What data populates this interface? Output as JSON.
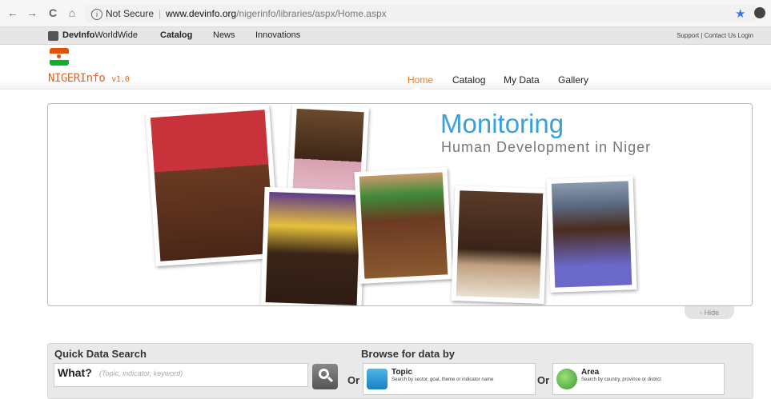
{
  "browser": {
    "back": "←",
    "forward": "→",
    "reload": "C",
    "home": "⌂",
    "security_label": "Not Secure",
    "url_domain": "www.devinfo.org",
    "url_path": "/nigerinfo/libraries/aspx/Home.aspx",
    "star": "★"
  },
  "topbar": {
    "brand_bold": "DevInfo",
    "brand_rest": "WorldWide",
    "items": [
      "Catalog",
      "News",
      "Innovations"
    ],
    "support": "Support | Contact Us Login"
  },
  "header": {
    "title": "NIGERInfo",
    "version": "v1.0",
    "nav": [
      "Home",
      "Catalog",
      "My Data",
      "Gallery"
    ],
    "active": "Home",
    "flag_colors": [
      "#e05206",
      "#ffffff",
      "#0db02b"
    ]
  },
  "banner": {
    "title": "Monitoring",
    "subtitle": "Human Development in Niger",
    "hide_label": "Hide"
  },
  "search": {
    "title": "Quick Data Search",
    "what_label": "What?",
    "what_placeholder": "(Topic, indicator, keyword)",
    "browse_title": "Browse for data by",
    "or_label": "Or",
    "topic_title": "Topic",
    "topic_desc": "Search by sector, goal, theme or indicator name",
    "area_title": "Area",
    "area_desc": "Search by country, province or district"
  },
  "colors": {
    "accent_orange": "#ef7d23",
    "accent_blue": "#3aa0dc"
  }
}
